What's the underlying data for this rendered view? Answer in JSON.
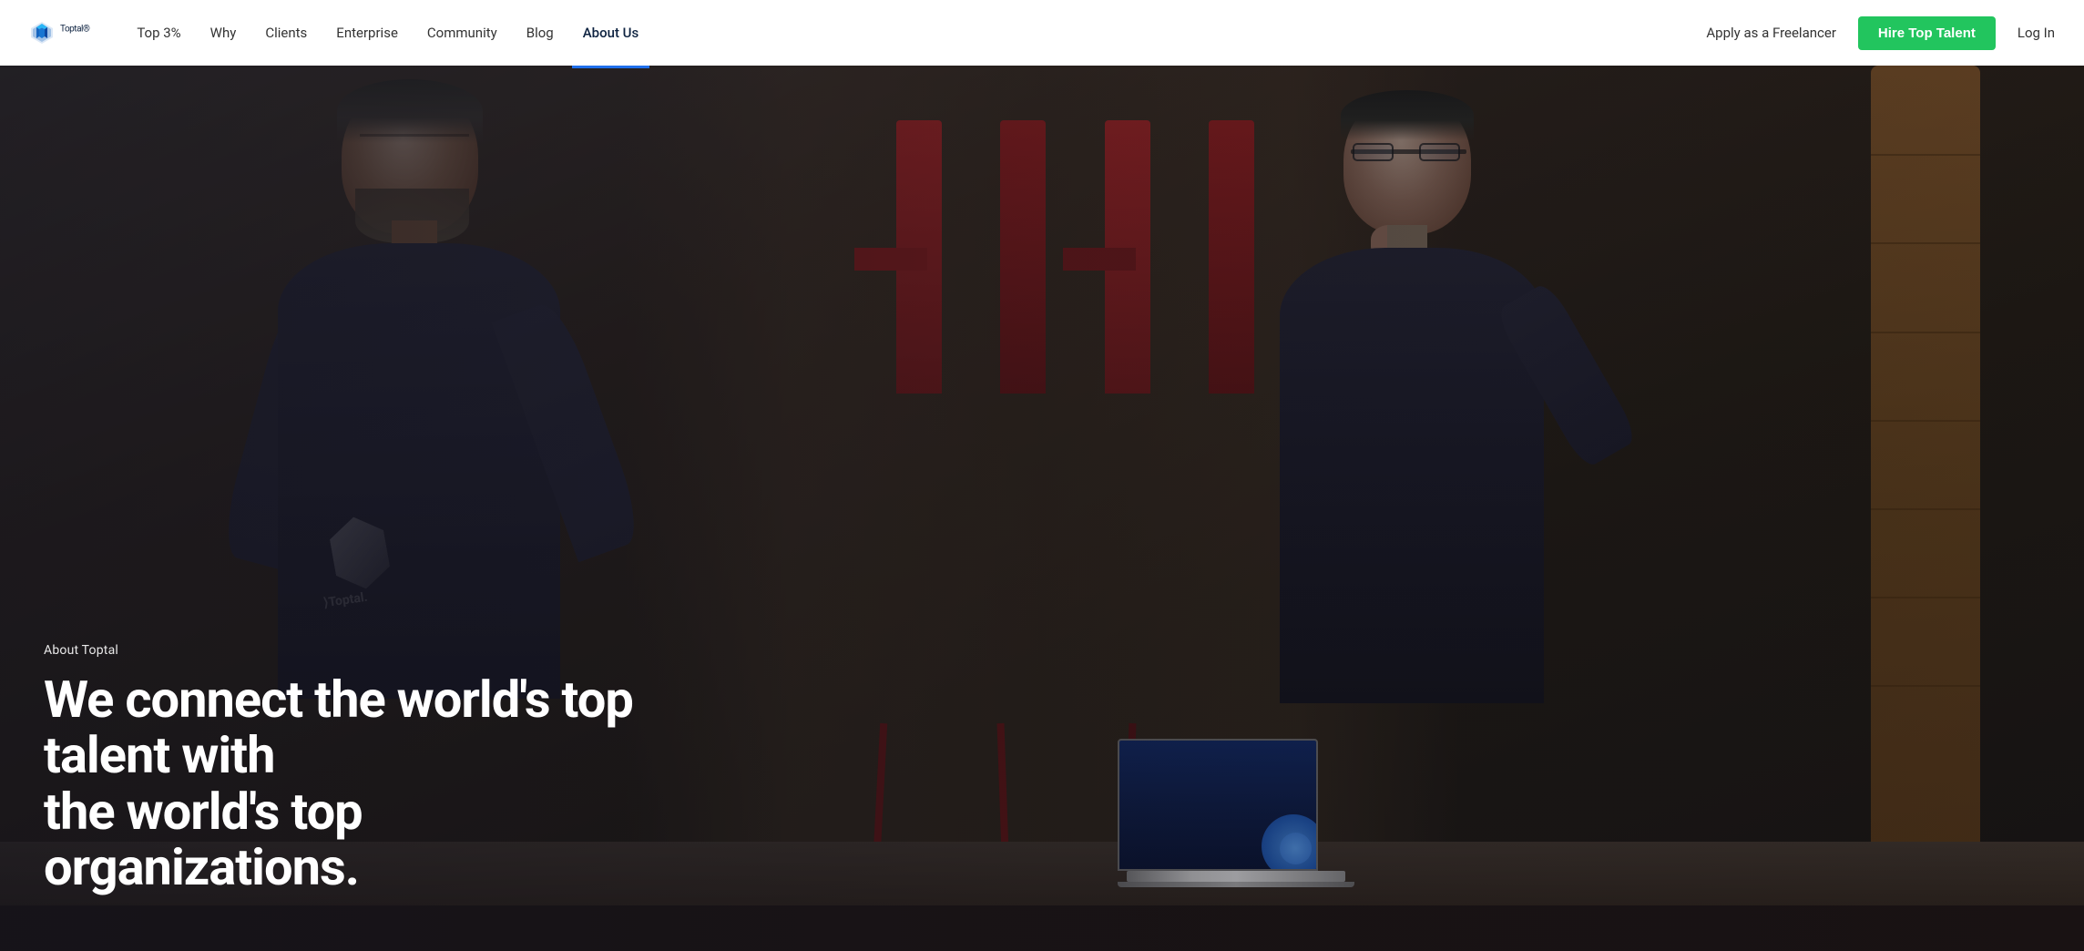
{
  "navbar": {
    "logo_text": "Toptal",
    "logo_registered": "®",
    "links": [
      {
        "id": "top3",
        "label": "Top 3%",
        "active": false
      },
      {
        "id": "why",
        "label": "Why",
        "active": false
      },
      {
        "id": "clients",
        "label": "Clients",
        "active": false
      },
      {
        "id": "enterprise",
        "label": "Enterprise",
        "active": false
      },
      {
        "id": "community",
        "label": "Community",
        "active": false
      },
      {
        "id": "blog",
        "label": "Blog",
        "active": false
      },
      {
        "id": "about",
        "label": "About Us",
        "active": true
      }
    ],
    "apply_label": "Apply as a Freelancer",
    "hire_label": "Hire Top Talent",
    "login_label": "Log In"
  },
  "hero": {
    "label": "About Toptal",
    "title_line1": "We connect the world's top talent with",
    "title_line2": "the world's top organizations.",
    "colors": {
      "hire_btn_bg": "#22c55e",
      "active_underline": "#1f6feb"
    }
  }
}
